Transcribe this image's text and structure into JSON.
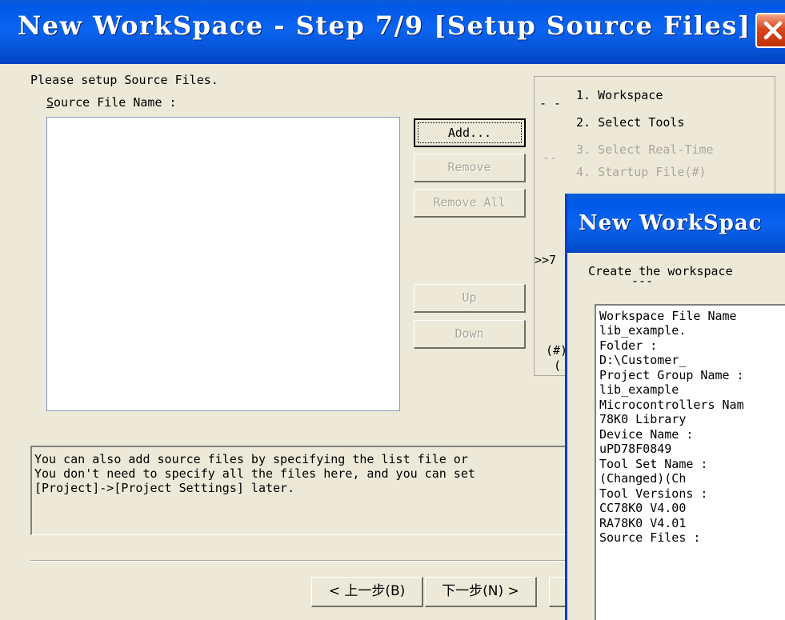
{
  "window": {
    "title": "New WorkSpace - Step 7/9 [Setup Source Files]",
    "close_icon": "close-icon"
  },
  "prompt": "Please setup Source Files.",
  "source_file_label": {
    "mnemonic": "S",
    "rest": "ource File Name :"
  },
  "buttons": {
    "add": "Add...",
    "remove": "Remove",
    "remove_all": "Remove All",
    "up": "Up",
    "down": "Down"
  },
  "steps": [
    {
      "label": "1. Workspace",
      "state": "enabled"
    },
    {
      "label": "2. Select Tools",
      "state": "enabled"
    },
    {
      "label": "3. Select Real-Time",
      "state": "disabled"
    },
    {
      "label": "4. Startup File(#)",
      "state": "disabled"
    }
  ],
  "steps_fragments": {
    "current_marker": ">>7",
    "note_marker": "(#)",
    "note_fragment": "("
  },
  "info_lines": [
    "You can also add source files by specifying the list file or",
    "You don't need to specify all the files here, and you can set",
    "[Project]->[Project Settings] later."
  ],
  "nav": {
    "back": "< 上一步(B)",
    "next": "下一步(N) >"
  },
  "overlay_dialog": {
    "title": "New WorkSpac",
    "heading": "Create the workspace",
    "summary_lines": [
      "Workspace File Name",
      "        lib_example.",
      "Folder :",
      "        D:\\Customer_",
      "Project Group Name :",
      "        lib_example",
      "Microcontrollers Nam",
      "        78K0 Library",
      "Device Name :",
      "        uPD78F0849",
      "Tool Set Name :",
      "        (Changed)(Ch",
      "Tool Versions :",
      "        CC78K0 V4.00",
      "        RA78K0 V4.01",
      "Source Files :"
    ]
  },
  "colors": {
    "titlebar": "#0058e6",
    "face": "#ece9d8",
    "close_button": "#d8461c",
    "disabled_text": "#aca899"
  }
}
